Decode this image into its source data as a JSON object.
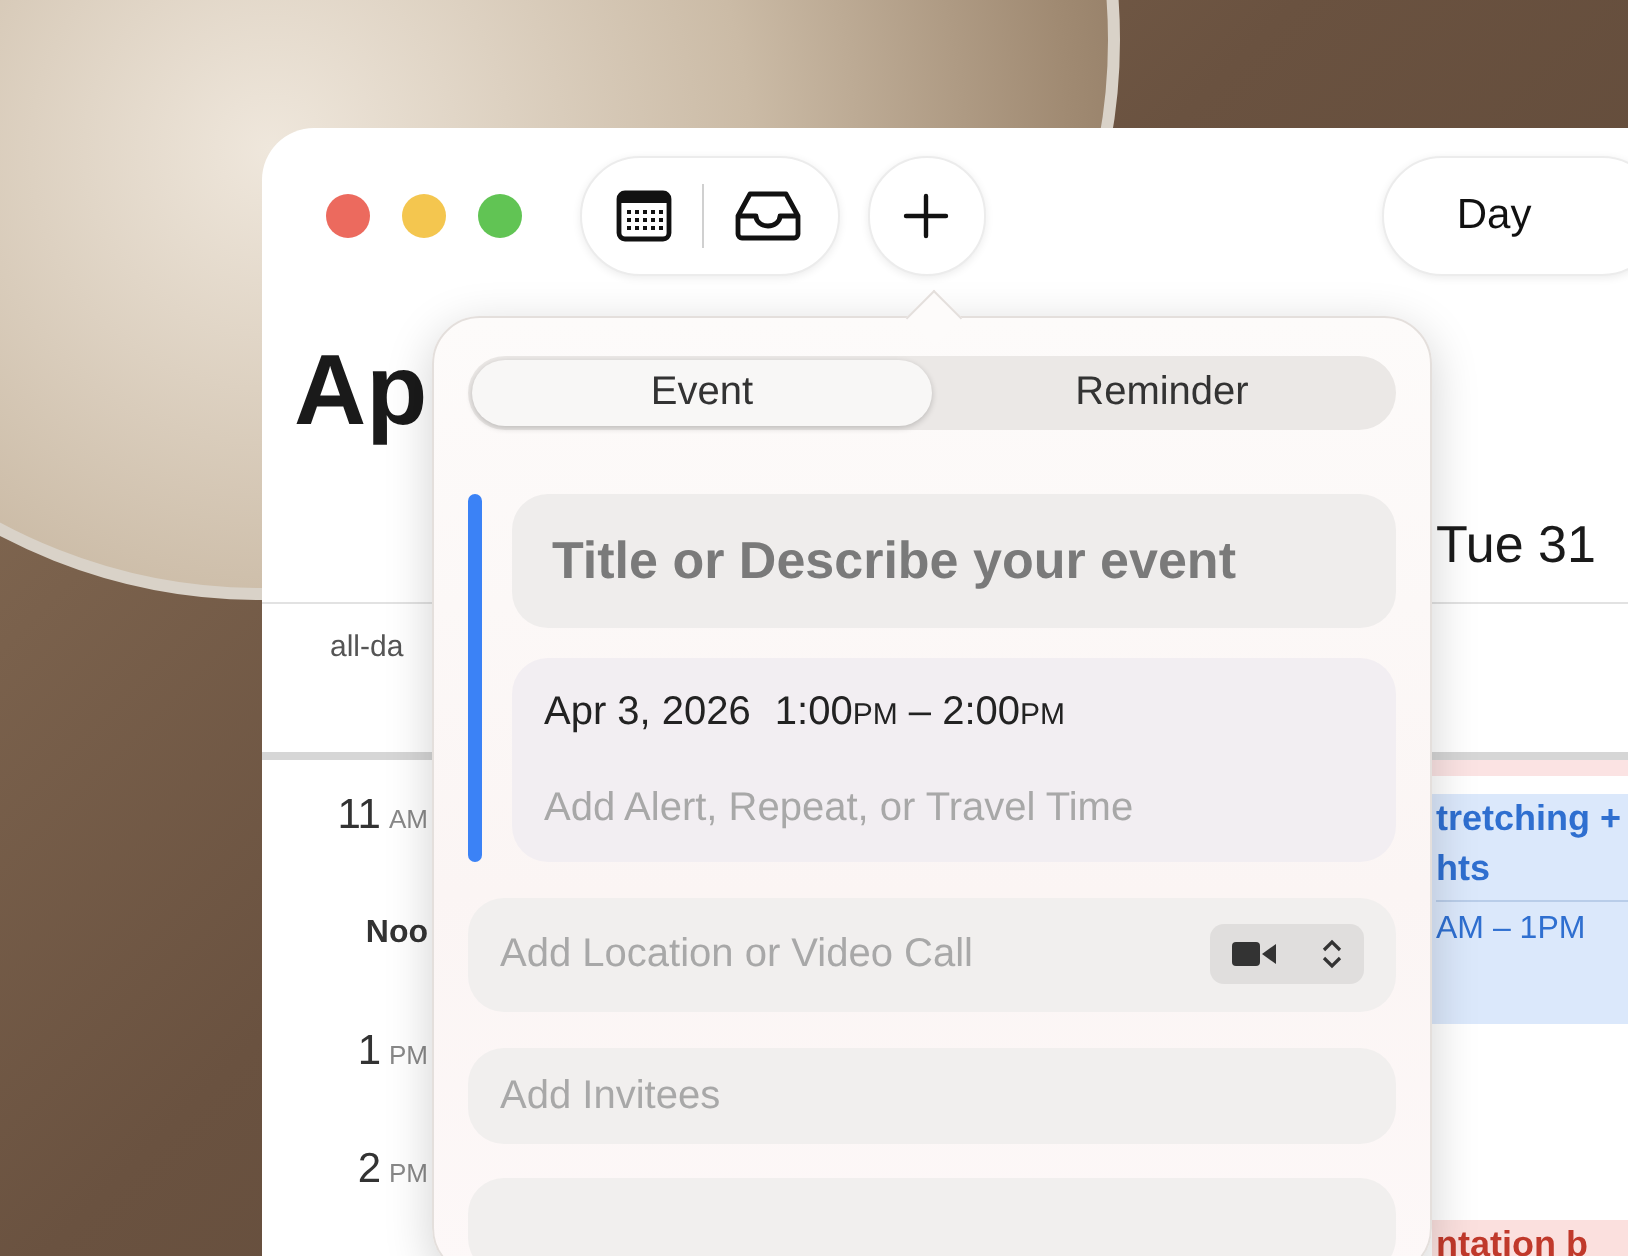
{
  "toolbar": {
    "view_button": {
      "label": "Day"
    }
  },
  "calendar": {
    "month_title": "Ap",
    "day_header": "Tue 31",
    "all_day_label": "all-da",
    "hours": [
      {
        "hour": "11",
        "period": "AM"
      },
      {
        "hour": "Noo"
      },
      {
        "hour": "1",
        "period": "PM"
      },
      {
        "hour": "2",
        "period": "PM"
      }
    ],
    "events": [
      {
        "lines": [
          "tretching +",
          "hts"
        ],
        "time": "AM – 1PM",
        "color": "#2f6fd0"
      },
      {
        "lines": [
          "ntation b"
        ],
        "color": "#c0392b"
      }
    ]
  },
  "new_item_popover": {
    "tabs": [
      {
        "label": "Event",
        "selected": true
      },
      {
        "label": "Reminder",
        "selected": false
      }
    ],
    "title_field": {
      "placeholder": "Title or Describe your event"
    },
    "date_time": {
      "date": "Apr 3, 2026",
      "start": "1:00",
      "start_period": "PM",
      "separator": "–",
      "end": "2:00",
      "end_period": "PM"
    },
    "details_field": {
      "placeholder": "Add Alert, Repeat, or Travel Time"
    },
    "location_field": {
      "placeholder": "Add Location or Video Call"
    },
    "invitees_field": {
      "placeholder": "Add Invitees"
    }
  }
}
